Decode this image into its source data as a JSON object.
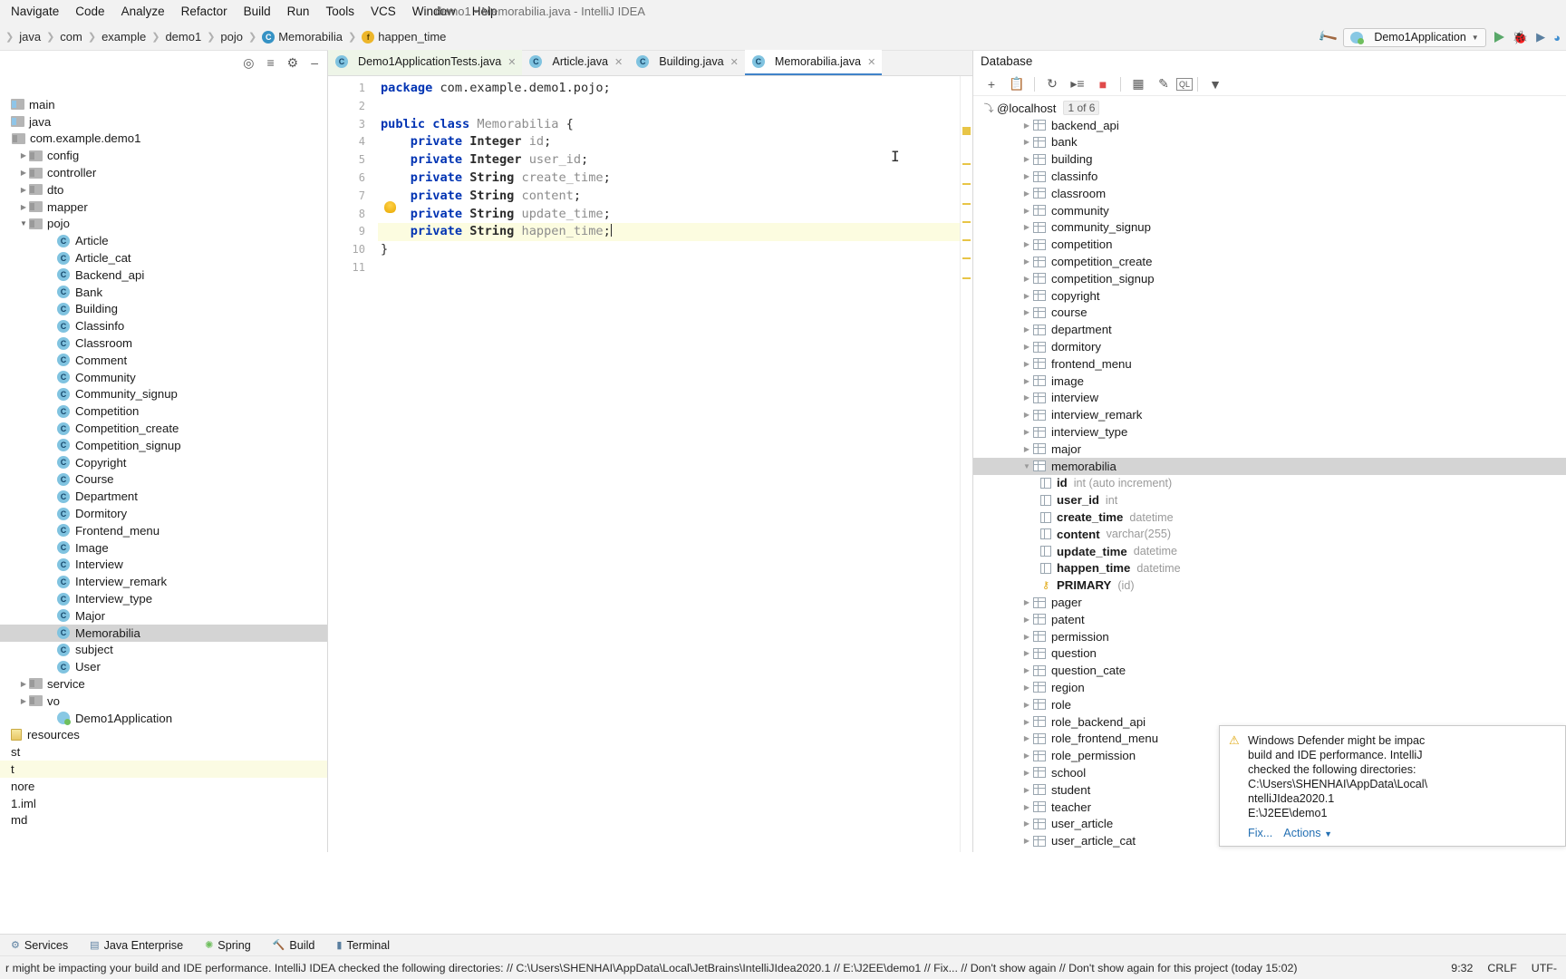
{
  "window": {
    "title": "demo1 - Memorabilia.java - IntelliJ IDEA"
  },
  "menubar": {
    "items": [
      "Navigate",
      "Code",
      "Analyze",
      "Refactor",
      "Build",
      "Run",
      "Tools",
      "VCS",
      "Window",
      "Help"
    ]
  },
  "breadcrumb": {
    "items": [
      {
        "label": "java",
        "icon": "folder-icon"
      },
      {
        "label": "com",
        "icon": "package-icon"
      },
      {
        "label": "example",
        "icon": "package-icon"
      },
      {
        "label": "demo1",
        "icon": "package-icon"
      },
      {
        "label": "pojo",
        "icon": "package-icon"
      },
      {
        "label": "Memorabilia",
        "icon": "class-icon"
      },
      {
        "label": "happen_time",
        "icon": "field-icon"
      }
    ]
  },
  "run_toolbar": {
    "config_name": "Demo1Application",
    "hammer_icon": "build-hammer-icon",
    "run_icon": "run-icon",
    "debug_icon": "debug-icon",
    "coverage_icon": "run-with-coverage-icon",
    "profile_icon": "profile-icon"
  },
  "project_panel": {
    "toolbar_icons": [
      "locate-icon",
      "collapse-all-icon",
      "settings-gear-icon",
      "hide-icon"
    ],
    "tree": [
      {
        "label": "main",
        "depth": 0,
        "type": "folder",
        "arrow": "",
        "clipped": true
      },
      {
        "label": "java",
        "depth": 0,
        "type": "folder",
        "arrow": "",
        "clipped": true
      },
      {
        "label": "com.example.demo1",
        "depth": 1,
        "type": "package",
        "arrow": ""
      },
      {
        "label": "config",
        "depth": 2,
        "type": "package",
        "arrow": "right"
      },
      {
        "label": "controller",
        "depth": 2,
        "type": "package",
        "arrow": "right"
      },
      {
        "label": "dto",
        "depth": 2,
        "type": "package",
        "arrow": "right"
      },
      {
        "label": "mapper",
        "depth": 2,
        "type": "package",
        "arrow": "right"
      },
      {
        "label": "pojo",
        "depth": 2,
        "type": "package",
        "arrow": "down"
      },
      {
        "label": "Article",
        "depth": 3,
        "type": "class",
        "arrow": ""
      },
      {
        "label": "Article_cat",
        "depth": 3,
        "type": "class",
        "arrow": ""
      },
      {
        "label": "Backend_api",
        "depth": 3,
        "type": "class",
        "arrow": ""
      },
      {
        "label": "Bank",
        "depth": 3,
        "type": "class",
        "arrow": ""
      },
      {
        "label": "Building",
        "depth": 3,
        "type": "class",
        "arrow": ""
      },
      {
        "label": "Classinfo",
        "depth": 3,
        "type": "class",
        "arrow": ""
      },
      {
        "label": "Classroom",
        "depth": 3,
        "type": "class",
        "arrow": ""
      },
      {
        "label": "Comment",
        "depth": 3,
        "type": "class",
        "arrow": ""
      },
      {
        "label": "Community",
        "depth": 3,
        "type": "class",
        "arrow": ""
      },
      {
        "label": "Community_signup",
        "depth": 3,
        "type": "class",
        "arrow": ""
      },
      {
        "label": "Competition",
        "depth": 3,
        "type": "class",
        "arrow": ""
      },
      {
        "label": "Competition_create",
        "depth": 3,
        "type": "class",
        "arrow": ""
      },
      {
        "label": "Competition_signup",
        "depth": 3,
        "type": "class",
        "arrow": ""
      },
      {
        "label": "Copyright",
        "depth": 3,
        "type": "class",
        "arrow": ""
      },
      {
        "label": "Course",
        "depth": 3,
        "type": "class",
        "arrow": ""
      },
      {
        "label": "Department",
        "depth": 3,
        "type": "class",
        "arrow": ""
      },
      {
        "label": "Dormitory",
        "depth": 3,
        "type": "class",
        "arrow": ""
      },
      {
        "label": "Frontend_menu",
        "depth": 3,
        "type": "class",
        "arrow": ""
      },
      {
        "label": "Image",
        "depth": 3,
        "type": "class",
        "arrow": ""
      },
      {
        "label": "Interview",
        "depth": 3,
        "type": "class",
        "arrow": ""
      },
      {
        "label": "Interview_remark",
        "depth": 3,
        "type": "class",
        "arrow": ""
      },
      {
        "label": "Interview_type",
        "depth": 3,
        "type": "class",
        "arrow": ""
      },
      {
        "label": "Major",
        "depth": 3,
        "type": "class",
        "arrow": ""
      },
      {
        "label": "Memorabilia",
        "depth": 3,
        "type": "class",
        "arrow": "",
        "selected": true
      },
      {
        "label": "subject",
        "depth": 3,
        "type": "class",
        "arrow": ""
      },
      {
        "label": "User",
        "depth": 3,
        "type": "class",
        "arrow": ""
      },
      {
        "label": "service",
        "depth": 2,
        "type": "package",
        "arrow": "right"
      },
      {
        "label": "vo",
        "depth": 2,
        "type": "package",
        "arrow": "right"
      },
      {
        "label": "Demo1Application",
        "depth": 3,
        "type": "spring-class",
        "arrow": ""
      },
      {
        "label": "resources",
        "depth": 0,
        "type": "resources",
        "arrow": "",
        "clipped": true
      },
      {
        "label": "st",
        "depth": 0,
        "type": "plain",
        "arrow": "",
        "clipped": true
      },
      {
        "label": "t",
        "depth": 0,
        "type": "plain",
        "arrow": "",
        "clipped": true,
        "highlight": true
      },
      {
        "label": "nore",
        "depth": 0,
        "type": "plain",
        "arrow": "",
        "clipped": true
      },
      {
        "label": "1.iml",
        "depth": 0,
        "type": "plain",
        "arrow": "",
        "clipped": true
      },
      {
        "label": "md",
        "depth": 0,
        "type": "plain",
        "arrow": "",
        "clipped": true
      }
    ]
  },
  "editor": {
    "tabs": [
      {
        "label": "Demo1ApplicationTests.java",
        "active": false
      },
      {
        "label": "Article.java",
        "active": false
      },
      {
        "label": "Building.java",
        "active": false
      },
      {
        "label": "Memorabilia.java",
        "active": true
      }
    ],
    "line_numbers": [
      "1",
      "2",
      "3",
      "4",
      "5",
      "6",
      "7",
      "8",
      "9",
      "10",
      "11"
    ],
    "lines": [
      {
        "n": 1,
        "segments": [
          {
            "t": "package ",
            "c": "kw"
          },
          {
            "t": "com.example.demo1.pojo;",
            "c": "pkgn"
          }
        ]
      },
      {
        "n": 2,
        "segments": []
      },
      {
        "n": 3,
        "segments": [
          {
            "t": "public ",
            "c": "kw"
          },
          {
            "t": "class ",
            "c": "kw"
          },
          {
            "t": "Memorabilia ",
            "c": "idf"
          },
          {
            "t": "{",
            "c": "pkgn"
          }
        ]
      },
      {
        "n": 4,
        "segments": [
          {
            "t": "    ",
            "c": "pkgn"
          },
          {
            "t": "private ",
            "c": "kw"
          },
          {
            "t": "Integer ",
            "c": "ty"
          },
          {
            "t": "id",
            "c": "idf"
          },
          {
            "t": ";",
            "c": "pkgn"
          }
        ]
      },
      {
        "n": 5,
        "segments": [
          {
            "t": "    ",
            "c": "pkgn"
          },
          {
            "t": "private ",
            "c": "kw"
          },
          {
            "t": "Integer ",
            "c": "ty"
          },
          {
            "t": "user_id",
            "c": "idf"
          },
          {
            "t": ";",
            "c": "pkgn"
          }
        ]
      },
      {
        "n": 6,
        "segments": [
          {
            "t": "    ",
            "c": "pkgn"
          },
          {
            "t": "private ",
            "c": "kw"
          },
          {
            "t": "String ",
            "c": "ty"
          },
          {
            "t": "create_time",
            "c": "idf"
          },
          {
            "t": ";",
            "c": "pkgn"
          }
        ]
      },
      {
        "n": 7,
        "segments": [
          {
            "t": "    ",
            "c": "pkgn"
          },
          {
            "t": "private ",
            "c": "kw"
          },
          {
            "t": "String ",
            "c": "ty"
          },
          {
            "t": "content",
            "c": "idf"
          },
          {
            "t": ";",
            "c": "pkgn"
          }
        ]
      },
      {
        "n": 8,
        "segments": [
          {
            "t": "    ",
            "c": "pkgn"
          },
          {
            "t": "private ",
            "c": "kw"
          },
          {
            "t": "String ",
            "c": "ty"
          },
          {
            "t": "update_time",
            "c": "idf"
          },
          {
            "t": ";",
            "c": "pkgn"
          }
        ]
      },
      {
        "n": 9,
        "segments": [
          {
            "t": "    ",
            "c": "pkgn"
          },
          {
            "t": "private ",
            "c": "kw"
          },
          {
            "t": "String ",
            "c": "ty"
          },
          {
            "t": "happen_time",
            "c": "idf"
          },
          {
            "t": ";",
            "c": "pkgn"
          }
        ],
        "current": true,
        "bulb": true
      },
      {
        "n": 10,
        "segments": [
          {
            "t": "}",
            "c": "pkgn"
          }
        ]
      },
      {
        "n": 11,
        "segments": []
      }
    ]
  },
  "database": {
    "title": "Database",
    "toolbar_icons": [
      "add-icon",
      "copy-icon",
      "refresh-icon",
      "run-sql-icon",
      "stop-icon",
      "table-editor-icon",
      "modify-icon",
      "sql-console-icon",
      "filter-icon"
    ],
    "connection": {
      "label": "@localhost",
      "badge": "1 of 6"
    },
    "tree": [
      {
        "label": "backend_api",
        "type": "table",
        "arrow": "right"
      },
      {
        "label": "bank",
        "type": "table",
        "arrow": "right"
      },
      {
        "label": "building",
        "type": "table",
        "arrow": "right"
      },
      {
        "label": "classinfo",
        "type": "table",
        "arrow": "right"
      },
      {
        "label": "classroom",
        "type": "table",
        "arrow": "right"
      },
      {
        "label": "community",
        "type": "table",
        "arrow": "right"
      },
      {
        "label": "community_signup",
        "type": "table",
        "arrow": "right"
      },
      {
        "label": "competition",
        "type": "table",
        "arrow": "right"
      },
      {
        "label": "competition_create",
        "type": "table",
        "arrow": "right"
      },
      {
        "label": "competition_signup",
        "type": "table",
        "arrow": "right"
      },
      {
        "label": "copyright",
        "type": "table",
        "arrow": "right"
      },
      {
        "label": "course",
        "type": "table",
        "arrow": "right"
      },
      {
        "label": "department",
        "type": "table",
        "arrow": "right"
      },
      {
        "label": "dormitory",
        "type": "table",
        "arrow": "right"
      },
      {
        "label": "frontend_menu",
        "type": "table",
        "arrow": "right"
      },
      {
        "label": "image",
        "type": "table",
        "arrow": "right"
      },
      {
        "label": "interview",
        "type": "table",
        "arrow": "right"
      },
      {
        "label": "interview_remark",
        "type": "table",
        "arrow": "right"
      },
      {
        "label": "interview_type",
        "type": "table",
        "arrow": "right"
      },
      {
        "label": "major",
        "type": "table",
        "arrow": "right"
      },
      {
        "label": "memorabilia",
        "type": "table",
        "arrow": "down",
        "selected": true
      },
      {
        "label": "id",
        "type": "column-pk",
        "datatype": "int (auto increment)"
      },
      {
        "label": "user_id",
        "type": "column-fk",
        "datatype": "int"
      },
      {
        "label": "create_time",
        "type": "column",
        "datatype": "datetime"
      },
      {
        "label": "content",
        "type": "column-fk",
        "datatype": "varchar(255)"
      },
      {
        "label": "update_time",
        "type": "column",
        "datatype": "datetime"
      },
      {
        "label": "happen_time",
        "type": "column-fk",
        "datatype": "datetime"
      },
      {
        "label": "PRIMARY",
        "type": "key",
        "datatype": "(id)"
      },
      {
        "label": "pager",
        "type": "table",
        "arrow": "right"
      },
      {
        "label": "patent",
        "type": "table",
        "arrow": "right"
      },
      {
        "label": "permission",
        "type": "table",
        "arrow": "right"
      },
      {
        "label": "question",
        "type": "table",
        "arrow": "right"
      },
      {
        "label": "question_cate",
        "type": "table",
        "arrow": "right"
      },
      {
        "label": "region",
        "type": "table",
        "arrow": "right"
      },
      {
        "label": "role",
        "type": "table",
        "arrow": "right"
      },
      {
        "label": "role_backend_api",
        "type": "table",
        "arrow": "right"
      },
      {
        "label": "role_frontend_menu",
        "type": "table",
        "arrow": "right"
      },
      {
        "label": "role_permission",
        "type": "table",
        "arrow": "right"
      },
      {
        "label": "school",
        "type": "table",
        "arrow": "right"
      },
      {
        "label": "student",
        "type": "table",
        "arrow": "right"
      },
      {
        "label": "teacher",
        "type": "table",
        "arrow": "right"
      },
      {
        "label": "user_article",
        "type": "table",
        "arrow": "right"
      },
      {
        "label": "user_article_cat",
        "type": "table",
        "arrow": "right"
      }
    ]
  },
  "notification": {
    "icon": "warning-icon",
    "lines": [
      "Windows Defender might be impac",
      "build and IDE performance. IntelliJ",
      "checked the following directories:",
      "C:\\Users\\SHENHAI\\AppData\\Local\\",
      "ntelliJIdea2020.1",
      "E:\\J2EE\\demo1"
    ],
    "links": [
      {
        "label": "Fix...",
        "has_chevron": true
      },
      {
        "label": "Actions",
        "has_chevron": true
      }
    ]
  },
  "tool_window_bar": {
    "items": [
      {
        "label": "Services",
        "icon": "services-icon"
      },
      {
        "label": "Java Enterprise",
        "icon": "java-enterprise-icon"
      },
      {
        "label": "Spring",
        "icon": "spring-icon"
      },
      {
        "label": "Build",
        "icon": "build-icon"
      },
      {
        "label": "Terminal",
        "icon": "terminal-icon"
      }
    ]
  },
  "statusbar": {
    "message": "r might be impacting your build and IDE performance. IntelliJ IDEA checked the following directories: // C:\\Users\\SHENHAI\\AppData\\Local\\JetBrains\\IntelliJIdea2020.1 // E:\\J2EE\\demo1 // Fix... // Don't show again // Don't show again for this project (today 15:02)",
    "caret": "9:32",
    "line_sep": "CRLF",
    "encoding": "UTF-"
  },
  "colors": {
    "accent_blue": "#4083c9",
    "keyword_blue": "#0033b3",
    "selection_gray": "#d4d4d4",
    "current_line": "#fcfce0",
    "warning_yellow": "#e0a810",
    "stripe_yellow": "#e8c547",
    "class_icon_blue": "#80c3e0"
  }
}
